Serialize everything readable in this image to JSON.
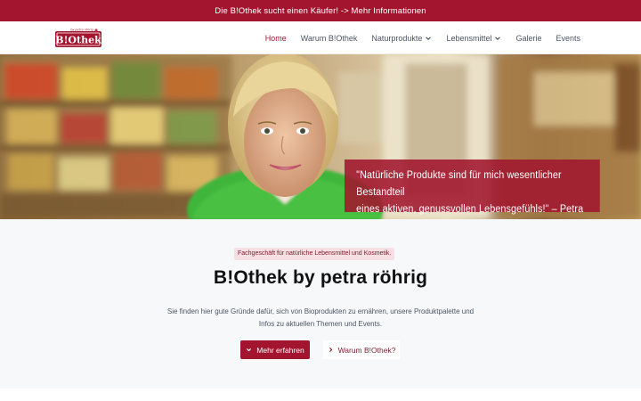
{
  "announcement": {
    "text": "Die B!Othek sucht einen Käufer! -> Mehr Informationen"
  },
  "brand": {
    "logo_text": "B!Othek",
    "logo_tagline": "by petra röhrig",
    "color": "#a3142e"
  },
  "nav": {
    "items": [
      {
        "label": "Home",
        "active": true,
        "dropdown": false
      },
      {
        "label": "Warum B!Othek",
        "active": false,
        "dropdown": false
      },
      {
        "label": "Naturprodukte",
        "active": false,
        "dropdown": true
      },
      {
        "label": "Lebensmittel",
        "active": false,
        "dropdown": true
      },
      {
        "label": "Galerie",
        "active": false,
        "dropdown": false
      },
      {
        "label": "Events",
        "active": false,
        "dropdown": false
      }
    ]
  },
  "hero": {
    "quote_line1": "\"Natürliche Produkte sind für mich wesentlicher Bestandteil",
    "quote_line2": "eines aktiven, genussvollen Lebensgefühls!\" – Petra Röhrig"
  },
  "intro": {
    "tag": "Fachgeschäft für natürliche Lebensmittel und Kosmetik.",
    "headline": "B!Othek by petra röhrig",
    "lead_line1": "Sie finden hier gute Gründe dafür, sich von Bioprodukten zu ernähren, unsere Produktpalette und",
    "lead_line2": "Infos zu aktuellen Themen und Events.",
    "primary_button": {
      "label": "Mehr erfahren",
      "icon": "chevron-down-icon"
    },
    "secondary_button": {
      "label": "Warum B!Othek?",
      "icon": "chevron-right-icon"
    }
  }
}
